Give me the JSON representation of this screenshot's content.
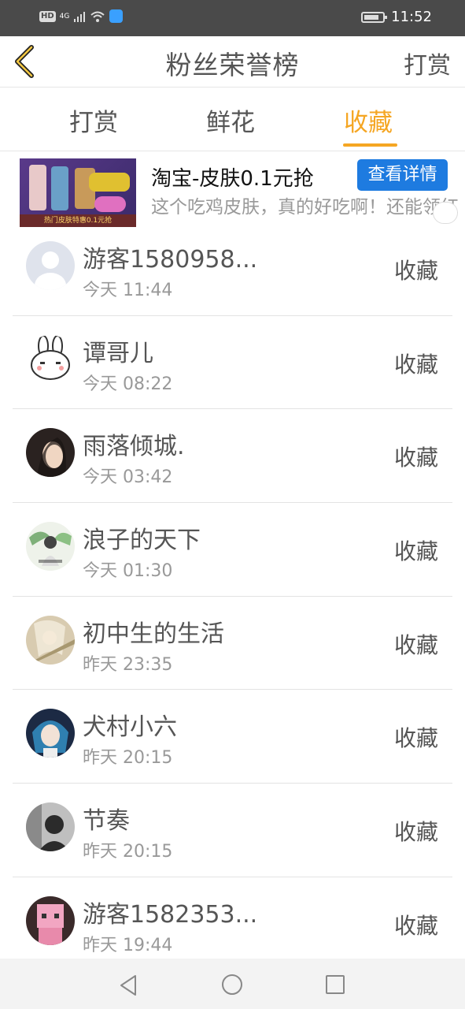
{
  "status_bar": {
    "hd_label": "HD",
    "network_label": "4G",
    "time": "11:52"
  },
  "header": {
    "title": "粉丝荣誉榜",
    "right_action": "打赏",
    "back_icon": "chevron-left-icon",
    "accent_color": "#f5a623"
  },
  "tabs": [
    {
      "label": "打赏",
      "active": false
    },
    {
      "label": "鲜花",
      "active": false
    },
    {
      "label": "收藏",
      "active": true
    }
  ],
  "ad": {
    "image_caption": "热门皮肤特惠0.1元抢",
    "title": "淘宝-皮肤0.1元抢",
    "button_label": "查看详情",
    "description": "这个吃鸡皮肤，真的好吃啊！还能领红包！",
    "button_color": "#1e7be0"
  },
  "fans": [
    {
      "name": "游客1580958...",
      "time": "今天 11:44",
      "action": "收藏",
      "avatar": "default-avatar"
    },
    {
      "name": "谭哥儿",
      "time": "今天 08:22",
      "action": "收藏",
      "avatar": "rabbit-avatar"
    },
    {
      "name": "雨落倾城.",
      "time": "今天 03:42",
      "action": "收藏",
      "avatar": "woman-portrait-avatar"
    },
    {
      "name": "浪子的天下",
      "time": "今天 01:30",
      "action": "收藏",
      "avatar": "ink-painting-avatar"
    },
    {
      "name": "初中生的生活",
      "time": "昨天 23:35",
      "action": "收藏",
      "avatar": "anime-avatar"
    },
    {
      "name": "犬村小六",
      "time": "昨天 20:15",
      "action": "收藏",
      "avatar": "anime-dark-avatar"
    },
    {
      "name": "节奏",
      "time": "昨天 20:15",
      "action": "收藏",
      "avatar": "photo-avatar"
    },
    {
      "name": "游客1582353...",
      "time": "昨天 19:44",
      "action": "收藏",
      "avatar": "pink-character-avatar"
    }
  ]
}
